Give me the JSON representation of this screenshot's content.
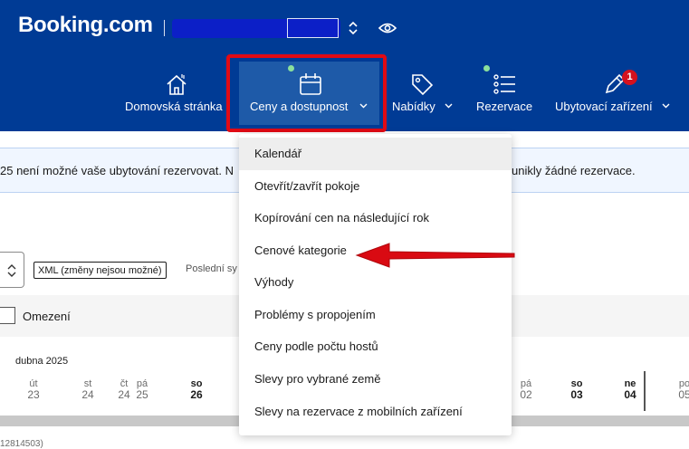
{
  "header": {
    "logo": "Booking.com",
    "nav": [
      {
        "label": "Domovská stránka",
        "icon": "house-icon"
      },
      {
        "label": "Ceny a dostupnost",
        "icon": "calendar-icon"
      },
      {
        "label": "Nabídky",
        "icon": "tag-icon"
      },
      {
        "label": "Rezervace",
        "icon": "list-icon"
      },
      {
        "label": "Ubytovací zařízení",
        "icon": "pencil-icon",
        "badge": "1"
      }
    ],
    "colors": {
      "header_bg": "#003b95",
      "highlight": "#e10a14",
      "dot": "#8be09c"
    }
  },
  "banner": {
    "left_text": "25 není možné vaše ubytování rezervovat. N",
    "right_text": "unikly žádné rezervace."
  },
  "controls": {
    "xml_tag": "XML (změny nejsou možné)",
    "last_sync": "Poslední sy",
    "restrictions_label": "Omezení"
  },
  "calendar": {
    "month": "dubna 2025",
    "days": [
      {
        "dow": "út",
        "num": "23",
        "bold": false
      },
      {
        "dow": "st",
        "num": "24",
        "bold": false
      },
      {
        "dow": "čt",
        "num": "24",
        "bold": false
      },
      {
        "dow": "pá",
        "num": "25",
        "bold": false
      },
      {
        "dow": "so",
        "num": "26",
        "bold": true
      },
      {
        "dow": "pá",
        "num": "02",
        "bold": false
      },
      {
        "dow": "so",
        "num": "03",
        "bold": true
      },
      {
        "dow": "ne",
        "num": "04",
        "bold": true
      },
      {
        "dow": "po",
        "num": "05",
        "bold": false
      }
    ],
    "room_id": "12814503)"
  },
  "dropdown": {
    "items": [
      "Kalendář",
      "Otevřít/zavřít pokoje",
      "Kopírování cen na následující rok",
      "Cenové kategorie",
      "Výhody",
      "Problémy s propojením",
      "Ceny podle počtu hostů",
      "Slevy pro vybrané země",
      "Slevy na rezervace z mobilních zařízení"
    ],
    "selected_index": 0,
    "pointed_index": 3
  }
}
